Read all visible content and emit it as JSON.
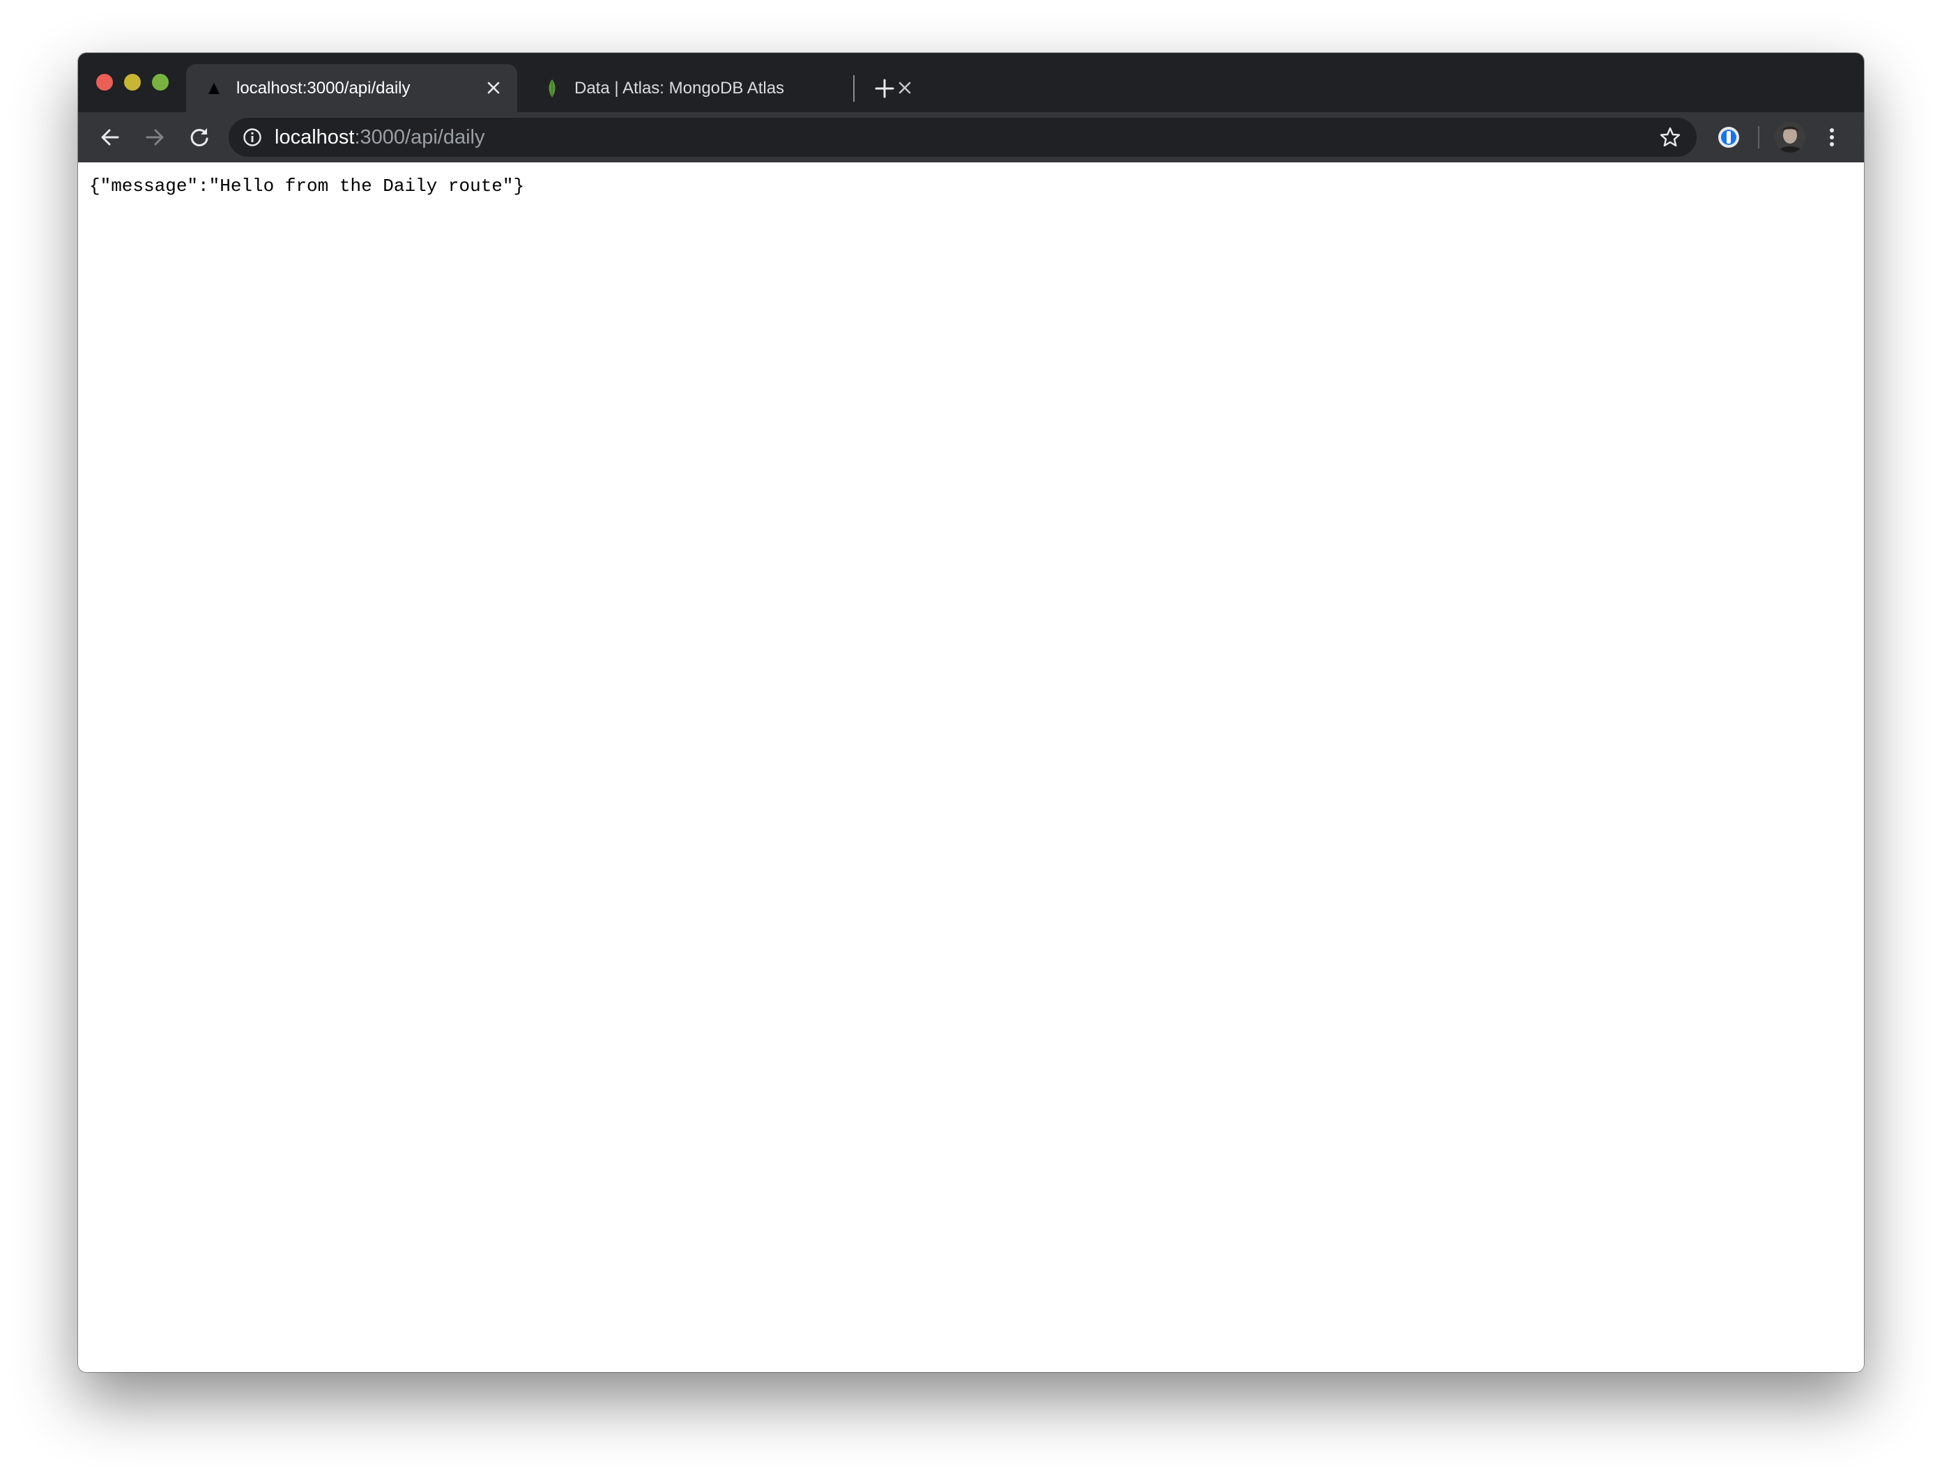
{
  "tabs": [
    {
      "title": "localhost:3000/api/daily",
      "active": true,
      "icon": "triangle-favicon-icon"
    },
    {
      "title": "Data | Atlas: MongoDB Atlas",
      "active": false,
      "icon": "mongodb-leaf-icon"
    }
  ],
  "omnibox": {
    "host": "localhost",
    "path": ":3000/api/daily"
  },
  "page": {
    "body_text": "{\"message\":\"Hello from the Daily route\"}"
  },
  "colors": {
    "titlebar": "#202124",
    "toolbar": "#35363a",
    "omnibox": "#202124",
    "close": "#ec5f57",
    "minimize": "#c7b533",
    "maximize": "#77b33e"
  }
}
